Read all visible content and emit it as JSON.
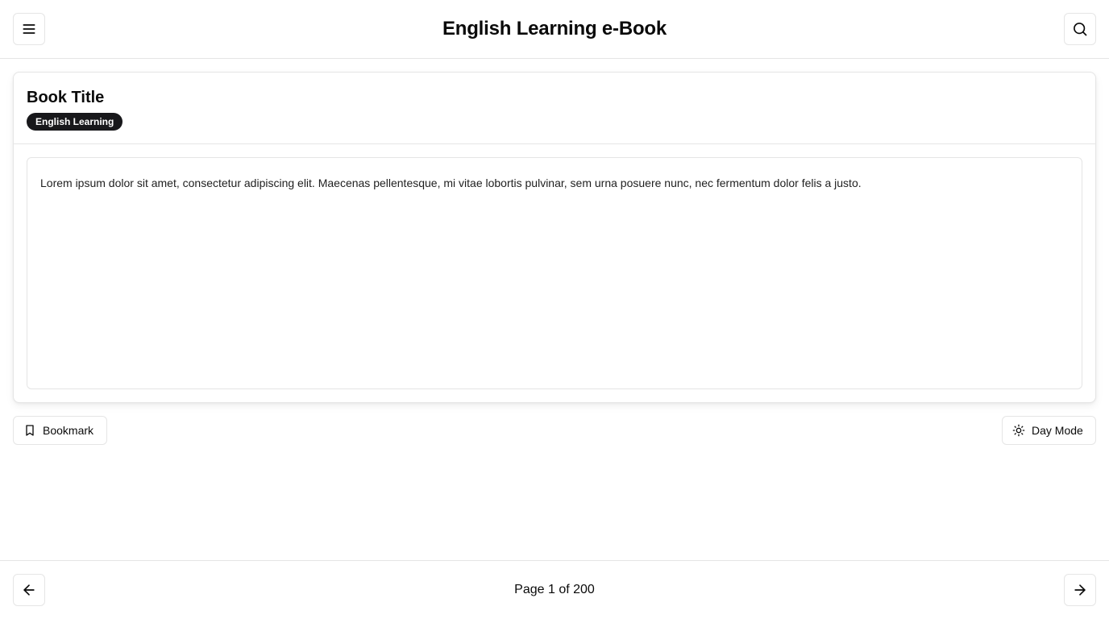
{
  "header": {
    "title": "English Learning e-Book",
    "menu_icon": "menu-icon",
    "search_icon": "search-icon"
  },
  "book": {
    "title": "Book Title",
    "category_badge": "English Learning",
    "content": "Lorem ipsum dolor sit amet, consectetur adipiscing elit. Maecenas pellentesque, mi vitae lobortis pulvinar, sem urna posuere nunc, nec fermentum dolor felis a justo."
  },
  "actions": {
    "bookmark_label": "Bookmark",
    "bookmark_icon": "bookmark-icon",
    "daymode_label": "Day Mode",
    "daymode_icon": "sun-icon"
  },
  "footer": {
    "page_indicator": "Page 1 of 200",
    "prev_icon": "arrow-left-icon",
    "next_icon": "arrow-right-icon"
  },
  "colors": {
    "badge_background": "#18181b",
    "border": "#e5e5e5",
    "text": "#0a0a0a"
  }
}
